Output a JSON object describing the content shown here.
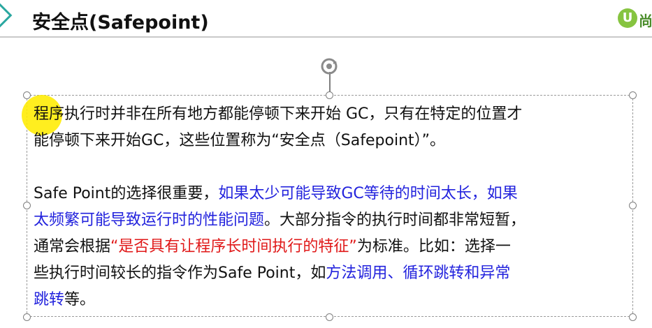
{
  "header": {
    "title": "安全点(Safepoint)",
    "logo_mark": "U",
    "logo_text": "尚"
  },
  "content": {
    "para1": {
      "line1": "程序执行时并非在所有地方都能停顿下来开始 GC，只有在特定的位置才",
      "line2": "能停顿下来开始GC，这些位置称为“安全点（Safepoint）”。"
    },
    "para2": {
      "l1_a": "Safe Point的选择很重要，",
      "l1_b": "如果太少可能导致GC等待的时间太长，如果",
      "l2_a": "太频繁可能导致运行时的性能问题",
      "l2_b": "。大部分指令的执行时间都非常短暂，",
      "l3_a": "通常会根据",
      "l3_b": "“是否具有让程序长时间执行的特征”",
      "l3_c": "为标准。比如：选择一",
      "l4_a": "些执行时间较长的指令作为Safe Point，如",
      "l4_b": "方法调用、循环跳转和异常",
      "l5_a": "跳转",
      "l5_b": "等。"
    }
  },
  "colors": {
    "emphasis_blue": "#2222dd",
    "emphasis_red": "#e01818",
    "accent_teal": "#2aa7a0",
    "cursor_highlight": "#ffec00"
  }
}
